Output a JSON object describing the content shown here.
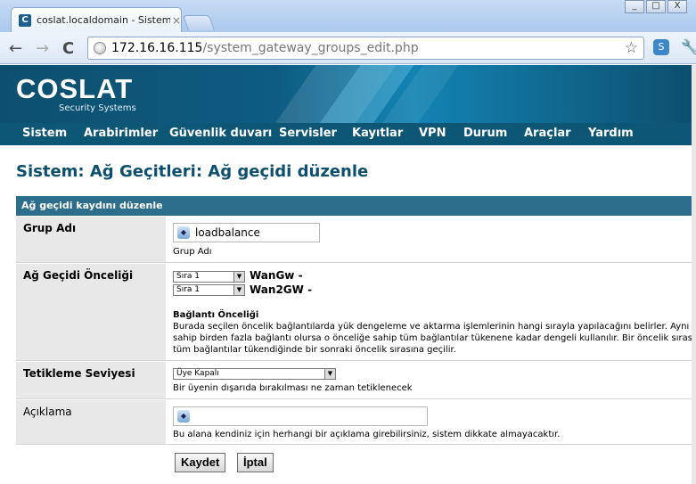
{
  "browser": {
    "tab_title": "coslat.localdomain - Sistem: A",
    "tab_close": "×",
    "favicon": "C",
    "url_host": "172.16.16.115",
    "url_path": "/system_gateway_groups_edit.php",
    "back_icon": "←",
    "forward_icon": "→",
    "reload_icon": "C",
    "star_icon": "☆",
    "ext_icon": "S",
    "wrench_icon": "🔧",
    "minimize": "_",
    "maximize": "□",
    "close": "X"
  },
  "header": {
    "logo": "COSLAT",
    "logo_sub": "Security Systems"
  },
  "menu": {
    "items": [
      "Sistem",
      "Arabirimler",
      "Güvenlik duvarı",
      "Servisler",
      "Kayıtlar",
      "VPN",
      "Durum",
      "Araçlar",
      "Yardım"
    ]
  },
  "page": {
    "title": "Sistem: Ağ Geçitleri: Ağ geçidi düzenle",
    "section_header": "Ağ geçidi kaydını düzenle"
  },
  "form": {
    "group_name": {
      "label": "Grup Adı",
      "value": "loadbalance",
      "help": "Grup Adı"
    },
    "priority": {
      "label": "Ağ Geçidi Önceliği",
      "gateways": [
        {
          "tier": "Sıra 1",
          "name": "WanGw -"
        },
        {
          "tier": "Sıra 1",
          "name": "Wan2GW -"
        }
      ],
      "sub_title": "Bağlantı Önceliği",
      "help_lines": [
        "Burada seçilen öncelik bağlantılarda yük dengeleme ve aktarma işlemlerinin hangi sırayla yapılacağını belirler. Aynı önceliğe",
        "sahip birden fazla bağlantı olursa o önceliğe sahip tüm bağlantılar tükenene kadar dengeli kullanılır. Bir öncelik sırasındaki",
        "tüm bağlantılar tükendiğinde bir sonraki öncelik sırasına geçilir."
      ]
    },
    "trigger": {
      "label": "Tetikleme Seviyesi",
      "value": "Üye Kapalı",
      "help": "Bir üyenin dışarıda bırakılması ne zaman tetiklenecek"
    },
    "description": {
      "label": "Açıklama",
      "value": "",
      "help": "Bu alana kendiniz için herhangi bir açıklama girebilirsiniz, sistem dikkate almayacaktır."
    },
    "save_label": "Kaydet",
    "cancel_label": "İptal"
  },
  "colors": {
    "brand_dark": "#0d4f6e",
    "menu_bar": "#0e5676",
    "section_header": "#2d6e8d",
    "label_bg": "#e8e8e8"
  }
}
